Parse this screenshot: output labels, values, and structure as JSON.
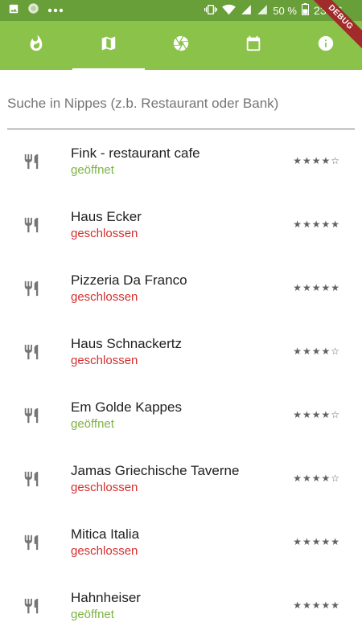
{
  "status_bar": {
    "battery_percent": "50 %",
    "time": "23:36",
    "icons": [
      "image-icon",
      "circle-app-icon",
      "dots-icon",
      "vibrate-icon",
      "wifi-icon",
      "signal-icon",
      "signal-r-icon",
      "battery-icon"
    ]
  },
  "debug_banner": "DEBUG",
  "tabs": [
    {
      "icon": "fire-icon",
      "selected": false
    },
    {
      "icon": "map-icon",
      "selected": true
    },
    {
      "icon": "aperture-icon",
      "selected": false
    },
    {
      "icon": "calendar-icon",
      "selected": false
    },
    {
      "icon": "info-icon",
      "selected": false
    }
  ],
  "search": {
    "placeholder": "Suche in Nippes (z.b. Restaurant oder Bank)",
    "value": ""
  },
  "colors": {
    "status_bar": "#689F38",
    "app_bar": "#8BC34A",
    "open": "#7CB342",
    "closed": "#D32F2F"
  },
  "places": [
    {
      "name": "Fink - restaurant cafe",
      "status": "geöffnet",
      "open": true,
      "rating": "★★★★☆",
      "icon": "restaurant-icon"
    },
    {
      "name": "Haus Ecker",
      "status": "geschlossen",
      "open": false,
      "rating": "★★★★★",
      "icon": "restaurant-icon"
    },
    {
      "name": "Pizzeria Da Franco",
      "status": "geschlossen",
      "open": false,
      "rating": "★★★★★",
      "icon": "restaurant-icon"
    },
    {
      "name": "Haus Schnackertz",
      "status": "geschlossen",
      "open": false,
      "rating": "★★★★☆",
      "icon": "restaurant-icon"
    },
    {
      "name": "Em Golde Kappes",
      "status": "geöffnet",
      "open": true,
      "rating": "★★★★☆",
      "icon": "restaurant-icon"
    },
    {
      "name": "Jamas Griechische Taverne",
      "status": "geschlossen",
      "open": false,
      "rating": "★★★★☆",
      "icon": "restaurant-icon"
    },
    {
      "name": "Mitica Italia",
      "status": "geschlossen",
      "open": false,
      "rating": "★★★★★",
      "icon": "restaurant-icon"
    },
    {
      "name": "Hahnheiser",
      "status": "geöffnet",
      "open": true,
      "rating": "★★★★★",
      "icon": "restaurant-icon"
    }
  ]
}
